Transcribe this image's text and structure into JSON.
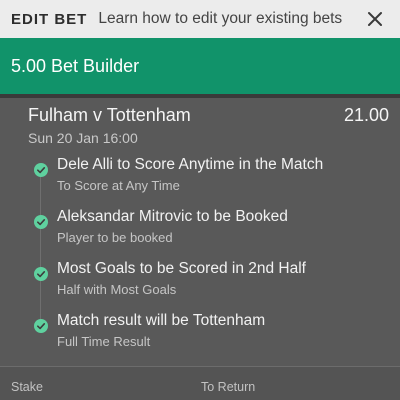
{
  "header": {
    "title": "EDIT BET",
    "help_text": "Learn how to edit your existing bets",
    "close_icon": "close-icon"
  },
  "bet": {
    "title": "5.00 Bet Builder",
    "accent_color": "#11936a"
  },
  "event": {
    "name": "Fulham v Tottenham",
    "odds": "21.00",
    "datetime": "Sun 20 Jan 16:00"
  },
  "legs": [
    {
      "selection": "Dele Alli to Score Anytime in the Match",
      "market": "To Score at Any Time",
      "icon": "check-circle-icon"
    },
    {
      "selection": "Aleksandar Mitrovic to be Booked",
      "market": "Player to be booked",
      "icon": "check-circle-icon"
    },
    {
      "selection": "Most Goals to be Scored in 2nd Half",
      "market": "Half with Most Goals",
      "icon": "check-circle-icon"
    },
    {
      "selection": "Match result will be Tottenham",
      "market": "Full Time Result",
      "icon": "check-circle-icon"
    }
  ],
  "footer": {
    "stake_label": "Stake",
    "return_label": "To Return"
  }
}
